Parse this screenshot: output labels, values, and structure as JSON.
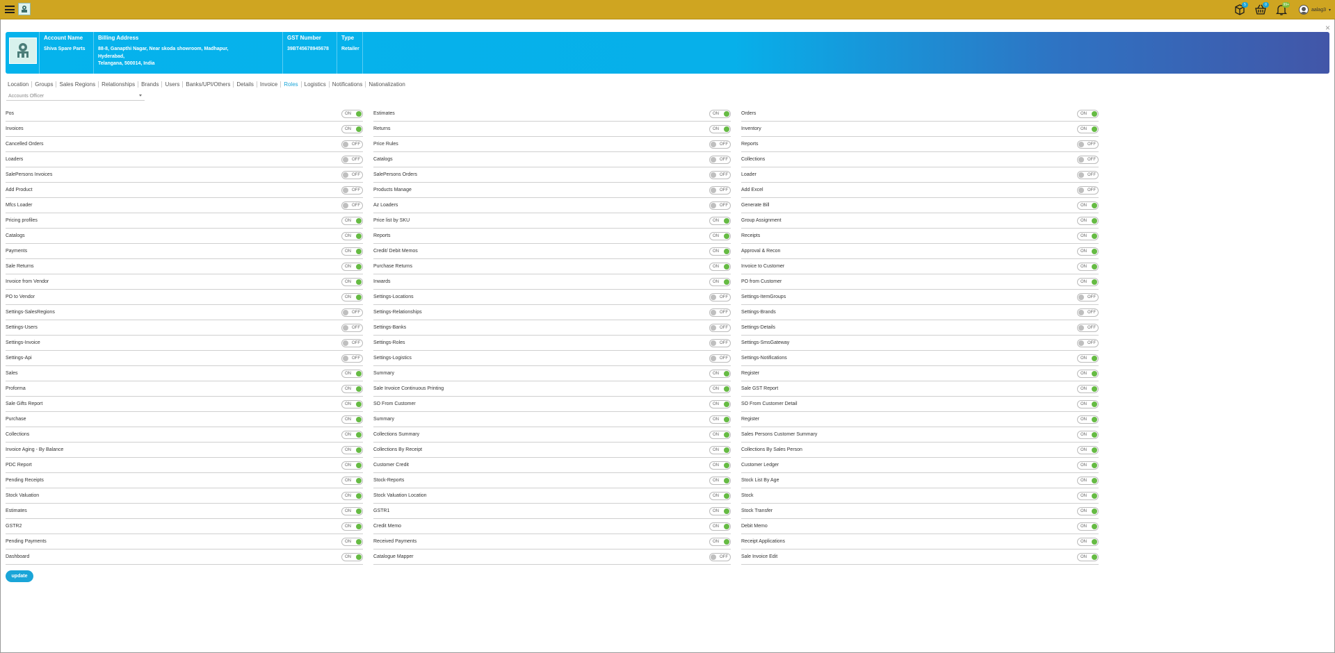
{
  "topbar": {
    "badges": {
      "box": "5",
      "basket": "0",
      "bell": "99+"
    },
    "user_name": "aalag3"
  },
  "account": {
    "name_label": "Account Name",
    "name_value": "Shiva Spare Parts",
    "address_label": "Billing Address",
    "address_line1": "88-8, Ganapthi Nagar, Near skoda showroom, Madhapur,",
    "address_line2": "Hyderabad,",
    "address_line3": "Telangana, 500014, India",
    "gst_label": "GST Number",
    "gst_value": "39BT45678945678",
    "type_label": "Type",
    "type_value": "Retailer"
  },
  "tabs": [
    "Location",
    "Groups",
    "Sales Regions",
    "Relationships",
    "Brands",
    "Users",
    "Banks/UPI/Others",
    "Details",
    "Invoice",
    "Roles",
    "Logistics",
    "Notifications",
    "Nationalization"
  ],
  "active_tab": "Roles",
  "role_select": {
    "value": "Accounts Officer"
  },
  "toggle_text": {
    "on": "ON",
    "off": "OFF"
  },
  "permissions": [
    [
      {
        "label": "Pos",
        "on": true
      },
      {
        "label": "Invoices",
        "on": true
      },
      {
        "label": "Cancelled Orders",
        "on": false
      },
      {
        "label": "Loaders",
        "on": false
      },
      {
        "label": "SalePersons Invoices",
        "on": false
      },
      {
        "label": "Add Product",
        "on": false
      },
      {
        "label": "Mfcs Loader",
        "on": false
      },
      {
        "label": "Pricing profiles",
        "on": true
      },
      {
        "label": "Catalogs",
        "on": true
      },
      {
        "label": "Payments",
        "on": true
      },
      {
        "label": "Sale Returns",
        "on": true
      },
      {
        "label": "Invoice from Vendor",
        "on": true
      },
      {
        "label": "PO to Vendor",
        "on": true
      },
      {
        "label": "Settings-SalesRegions",
        "on": false
      },
      {
        "label": "Settings-Users",
        "on": false
      },
      {
        "label": "Settings-Invoice",
        "on": false
      },
      {
        "label": "Settings-Api",
        "on": false
      },
      {
        "label": "Sales",
        "on": true
      },
      {
        "label": "Proforma",
        "on": true
      },
      {
        "label": "Sale Gifts Report",
        "on": true
      },
      {
        "label": "Purchase",
        "on": true
      },
      {
        "label": "Collections",
        "on": true
      },
      {
        "label": "Invoice Aging - By Balance",
        "on": true
      },
      {
        "label": "PDC Report",
        "on": true
      },
      {
        "label": "Pending Receipts",
        "on": true
      },
      {
        "label": "Stock Valuation",
        "on": true
      },
      {
        "label": "Estimates",
        "on": true
      },
      {
        "label": "GSTR2",
        "on": true
      },
      {
        "label": "Pending Payments",
        "on": true
      },
      {
        "label": "Dashboard",
        "on": true
      }
    ],
    [
      {
        "label": "Estimates",
        "on": true
      },
      {
        "label": "Returns",
        "on": true
      },
      {
        "label": "Price Rules",
        "on": false
      },
      {
        "label": "Catalogs",
        "on": false
      },
      {
        "label": "SalePersons Orders",
        "on": false
      },
      {
        "label": "Products Manage",
        "on": false
      },
      {
        "label": "Az Loaders",
        "on": false
      },
      {
        "label": "Price list by SKU",
        "on": true
      },
      {
        "label": "Reports",
        "on": true
      },
      {
        "label": "Credit/ Debit Memos",
        "on": true
      },
      {
        "label": "Purchase Returns",
        "on": true
      },
      {
        "label": "Inwards",
        "on": true
      },
      {
        "label": "Settings-Locations",
        "on": false
      },
      {
        "label": "Settings-Relationships",
        "on": false
      },
      {
        "label": "Settings-Banks",
        "on": false
      },
      {
        "label": "Settings-Roles",
        "on": false
      },
      {
        "label": "Settings-Logistics",
        "on": false
      },
      {
        "label": "Summary",
        "on": true
      },
      {
        "label": "Sale Invoice Continuous Printing",
        "on": true
      },
      {
        "label": "SO From Customer",
        "on": true
      },
      {
        "label": "Summary",
        "on": true
      },
      {
        "label": "Collections Summary",
        "on": true
      },
      {
        "label": "Collections By Receipt",
        "on": true
      },
      {
        "label": "Customer Credit",
        "on": true
      },
      {
        "label": "Stock-Reports",
        "on": true
      },
      {
        "label": "Stock Valuation Location",
        "on": true
      },
      {
        "label": "GSTR1",
        "on": true
      },
      {
        "label": "Credit Memo",
        "on": true
      },
      {
        "label": "Received Payments",
        "on": true
      },
      {
        "label": "Catalogue Mapper",
        "on": false
      }
    ],
    [
      {
        "label": "Orders",
        "on": true
      },
      {
        "label": "Inventory",
        "on": true
      },
      {
        "label": "Reports",
        "on": false
      },
      {
        "label": "Collections",
        "on": false
      },
      {
        "label": "Loader",
        "on": false
      },
      {
        "label": "Add Excel",
        "on": false
      },
      {
        "label": "Generate Bill",
        "on": true
      },
      {
        "label": "Group Assignment",
        "on": true
      },
      {
        "label": "Receipts",
        "on": true
      },
      {
        "label": "Approval & Recon",
        "on": true
      },
      {
        "label": "Invoice to Customer",
        "on": true
      },
      {
        "label": "PO from Customer",
        "on": true
      },
      {
        "label": "Settings-ItemGroups",
        "on": false
      },
      {
        "label": "Settings-Brands",
        "on": false
      },
      {
        "label": "Settings-Details",
        "on": false
      },
      {
        "label": "Settings-SmsGateway",
        "on": false
      },
      {
        "label": "Settings-Notifications",
        "on": true
      },
      {
        "label": "Register",
        "on": true
      },
      {
        "label": "Sale GST Report",
        "on": true
      },
      {
        "label": "SO From Customer Detail",
        "on": true
      },
      {
        "label": "Register",
        "on": true
      },
      {
        "label": "Sales Persons Customer Summary",
        "on": true
      },
      {
        "label": "Collections By Sales Person",
        "on": true
      },
      {
        "label": "Customer Ledger",
        "on": true
      },
      {
        "label": "Stock List By Age",
        "on": true
      },
      {
        "label": "Stock",
        "on": true
      },
      {
        "label": "Stock Transfer",
        "on": true
      },
      {
        "label": "Debit Memo",
        "on": true
      },
      {
        "label": "Receipt Applications",
        "on": true
      },
      {
        "label": "Sale Invoice Edit",
        "on": true
      }
    ]
  ],
  "update_label": "update",
  "colors": {
    "topbar": "#cfa521",
    "banner_start": "#05b3ec",
    "banner_end": "#4256a8",
    "accent": "#1aa5d8",
    "toggle_on": "#66bb44"
  }
}
